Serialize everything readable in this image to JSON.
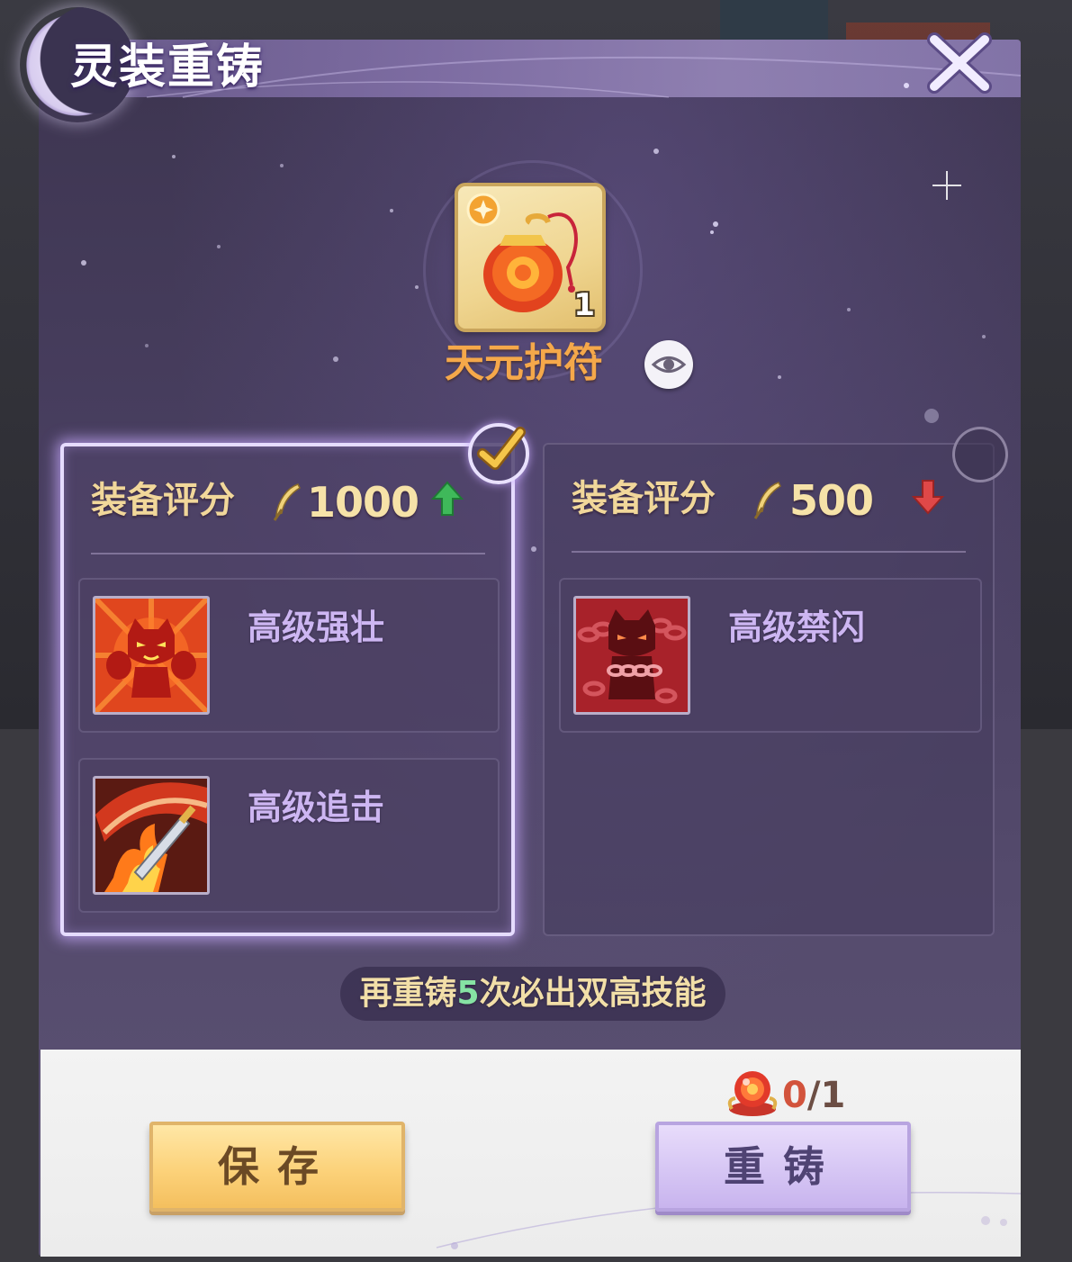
{
  "dialog": {
    "title": "灵装重铸"
  },
  "item": {
    "name": "天元护符",
    "count": "1",
    "icon": "amulet-pouch-icon"
  },
  "options": [
    {
      "score_label": "装备评分",
      "score_value": "1000",
      "trend": "up",
      "trend_color": "#3fb95a",
      "selected": true,
      "skills": [
        {
          "name": "高级强壮",
          "icon": "flexing-cat-icon"
        },
        {
          "name": "高级追击",
          "icon": "flaming-sword-icon"
        }
      ]
    },
    {
      "score_label": "装备评分",
      "score_value": "500",
      "trend": "down",
      "trend_color": "#e04848",
      "selected": false,
      "skills": [
        {
          "name": "高级禁闪",
          "icon": "chained-cat-icon"
        }
      ]
    }
  ],
  "hint": {
    "prefix": "再重铸",
    "count": "5",
    "suffix": "次必出双高技能"
  },
  "cost": {
    "current": "0",
    "required": "/1",
    "icon": "reforge-orb-icon"
  },
  "buttons": {
    "save": "保存",
    "reforge": "重铸"
  },
  "colors": {
    "accent_gold": "#f5a84a",
    "skill_text": "#cdb6f2",
    "selected_glow": "#e6dcff"
  }
}
